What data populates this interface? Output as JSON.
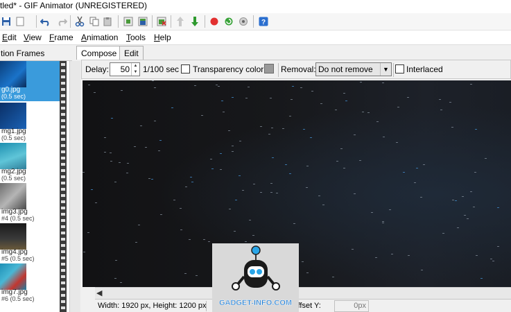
{
  "window": {
    "title": "tled* - GIF Animator (UNREGISTERED)"
  },
  "toolbar": {
    "buttons": [
      "save-icon",
      "blank-icon",
      "undo-icon",
      "redo-icon",
      "cut-icon",
      "copy-icon",
      "paste-icon",
      "insert-frame-icon",
      "add-frame-icon",
      "delete-frame-icon",
      "move-up-icon",
      "move-down-icon",
      "record-icon",
      "refresh-icon",
      "stop-icon",
      "help-icon"
    ]
  },
  "menu": {
    "edit": "Edit",
    "view": "View",
    "frame": "Frame",
    "animation": "Animation",
    "tools": "Tools",
    "help": "Help"
  },
  "frames_panel": {
    "header": "tion Frames",
    "frames": [
      {
        "name": "g0.jpg",
        "duration": "(0.5 sec)"
      },
      {
        "name": "mg1.jpg",
        "duration": "(0.5 sec)"
      },
      {
        "name": "mg2.jpg",
        "duration": "(0.5 sec)"
      },
      {
        "name": "img3.jpg",
        "duration": "#4 (0.5 sec)"
      },
      {
        "name": "img4.jpg",
        "duration": "#5 (0.5 sec)"
      },
      {
        "name": "img7.jpg",
        "duration": "#6 (0.5 sec)"
      }
    ]
  },
  "tabs": {
    "compose": "Compose",
    "edit": "Edit"
  },
  "properties": {
    "delay_label": "Delay:",
    "delay_value": "50",
    "delay_unit": "1/100 sec",
    "transparency_label": "Transparency color:",
    "transparency_checked": false,
    "transparency_color": "#9a9a9a",
    "removal_label": "Removal:",
    "removal_value": "Do not remove",
    "interlaced_label": "Interlaced",
    "interlaced_checked": false
  },
  "status": {
    "size_text": "Width: 1920 px, Height: 1200 px",
    "offset_y_label": "Offset Y:",
    "offset_y_value": "0px"
  },
  "watermark": {
    "text": "GADGET-INFO.COM"
  },
  "colors": {
    "selected_frame": "#3a9bdc",
    "canvas_dark": "#17181b",
    "watermark_blue": "#1e7ed6"
  }
}
